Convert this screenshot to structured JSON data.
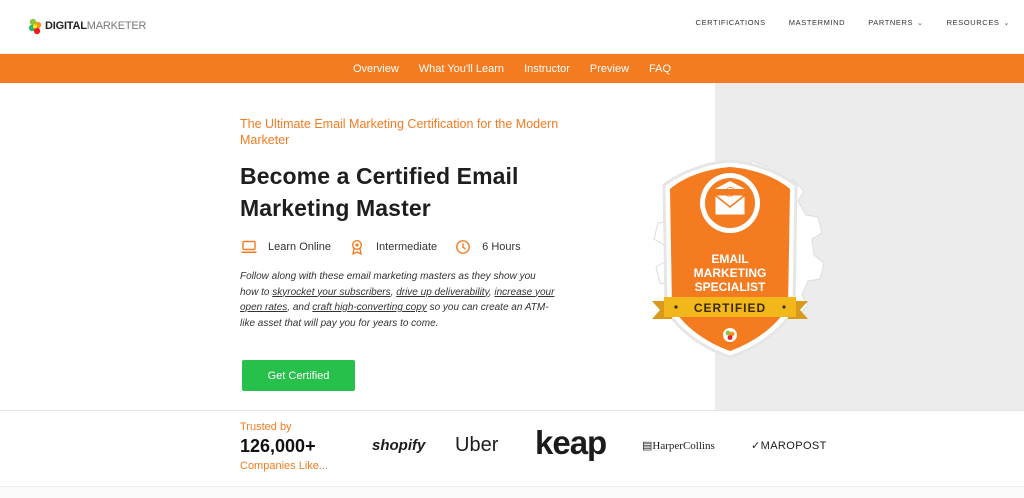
{
  "header": {
    "logo": {
      "strong": "DIGITAL",
      "light": "MARKETER"
    },
    "nav": [
      {
        "label": "CERTIFICATIONS",
        "dropdown": false
      },
      {
        "label": "MASTERMIND",
        "dropdown": false
      },
      {
        "label": "PARTNERS",
        "dropdown": true
      },
      {
        "label": "RESOURCES",
        "dropdown": true
      }
    ]
  },
  "subnav": [
    "Overview",
    "What You'll Learn",
    "Instructor",
    "Preview",
    "FAQ"
  ],
  "hero": {
    "eyebrow": "The Ultimate Email Marketing Certification for the Modern Marketer",
    "headline": "Become a Certified Email Marketing Master",
    "meta": [
      {
        "icon": "laptop-icon",
        "label": "Learn Online"
      },
      {
        "icon": "award-icon",
        "label": "Intermediate"
      },
      {
        "icon": "clock-icon",
        "label": "6 Hours"
      }
    ],
    "description": {
      "p1": "Follow along with these email marketing masters as they show you how to ",
      "l1": "skyrocket your subscribers",
      "p2": ", ",
      "l2": "drive up deliverability",
      "p3": ", ",
      "l3": "increase your open rates",
      "p4": ", and ",
      "l4": "craft high-converting copy",
      "p5": " so you can create an ATM-like asset that will pay you for years to come."
    },
    "cta": "Get Certified",
    "badge": {
      "line1": "EMAIL",
      "line2": "MARKETING",
      "line3": "SPECIALIST",
      "ribbon": "CERTIFIED"
    }
  },
  "trusted": {
    "label": "Trusted by",
    "count": "126,000+",
    "sub": "Companies Like...",
    "brands": [
      "shopify",
      "Uber",
      "keap",
      "HarperCollins",
      "MAROPOST"
    ]
  },
  "colors": {
    "orange": "#f47b20",
    "green": "#26c04a",
    "gray_panel": "#ececec",
    "gold": "#f2b81b"
  }
}
